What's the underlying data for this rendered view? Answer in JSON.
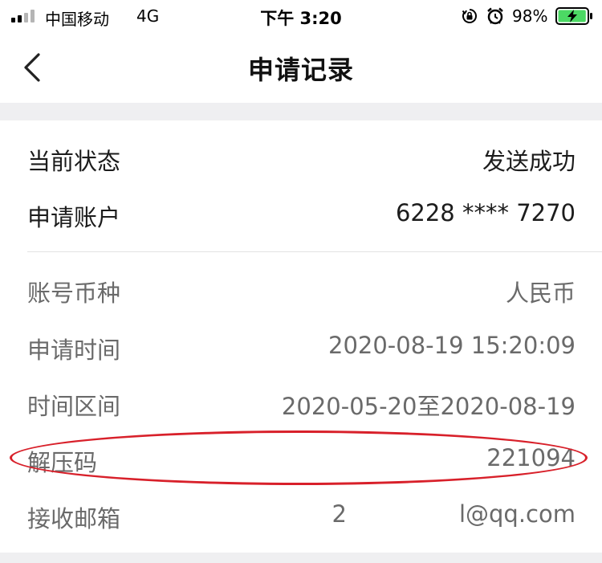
{
  "status_bar": {
    "carrier": "中国移动",
    "network": "4G",
    "time": "下午 3:20",
    "battery_percent": "98%",
    "battery_level": 0.98,
    "icons": [
      "signal-bars-icon",
      "rotation-lock-icon",
      "alarm-icon",
      "battery-charging-icon"
    ]
  },
  "nav": {
    "title": "申请记录",
    "back_icon": "chevron-left-icon"
  },
  "details": {
    "status": {
      "label": "当前状态",
      "value": "发送成功"
    },
    "account": {
      "label": "申请账户",
      "value": "6228 **** 7270"
    },
    "currency": {
      "label": "账号币种",
      "value": "人民币"
    },
    "apply_time": {
      "label": "申请时间",
      "value": "2020-08-19 15:20:09"
    },
    "period": {
      "label": "时间区间",
      "value": "2020-05-20至2020-08-19"
    },
    "unzip_code": {
      "label": "解压码",
      "value": "221094"
    },
    "email": {
      "label": "接收邮箱",
      "value_prefix": "2",
      "value_suffix": "l@qq.com"
    }
  },
  "colors": {
    "background": "#ffffff",
    "separator_band": "#efeff1",
    "primary_text": "#1c1c1c",
    "secondary_text": "#6a6a6a",
    "highlight_ring": "#d8202a",
    "battery_green": "#4cd964"
  }
}
